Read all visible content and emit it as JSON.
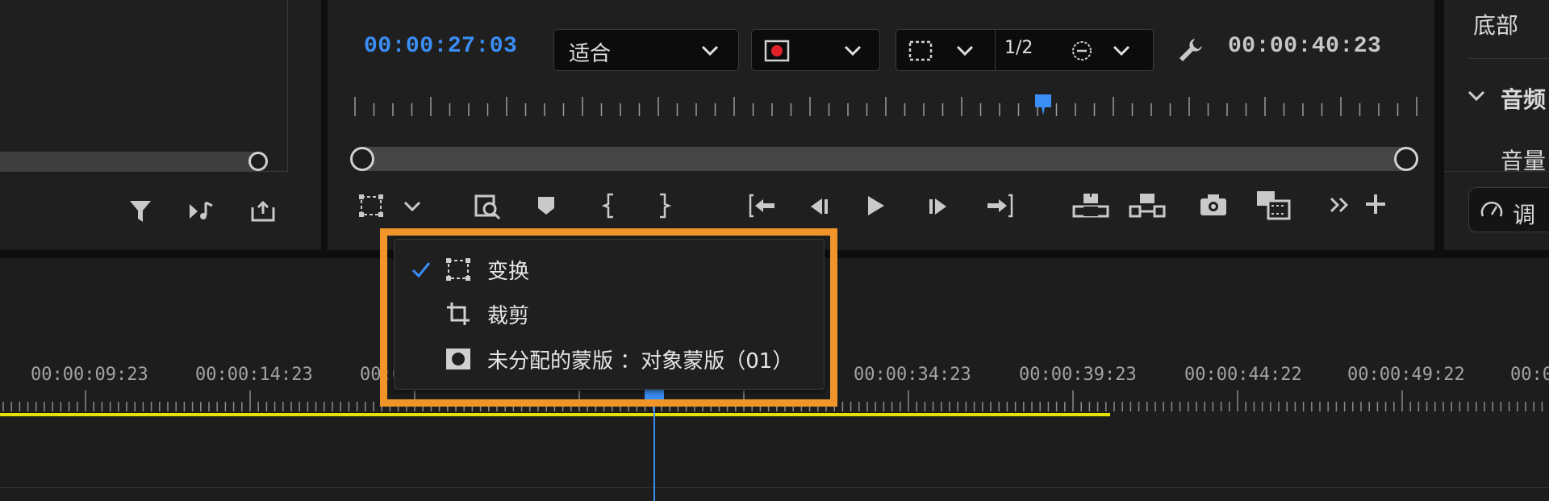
{
  "source_panel": {
    "icons": [
      "filter-icon",
      "audio-output-icon",
      "export-icon"
    ]
  },
  "program_monitor": {
    "current_timecode": "00:00:27:03",
    "zoom_select": "适合",
    "resolution_label": "1/2",
    "duration_timecode": "00:00:40:23"
  },
  "overlay_menu": {
    "items": [
      {
        "label": "变换",
        "checked": true,
        "icon": "transform-icon"
      },
      {
        "label": "裁剪",
        "checked": false,
        "icon": "crop-icon"
      },
      {
        "label": "未分配的蒙版 ：对象蒙版（01）",
        "checked": false,
        "icon": "mask-icon"
      }
    ]
  },
  "timeline": {
    "ruler_labels": [
      "00:00:09:23",
      "00:00:14:23",
      "00:0",
      "00:00:34:23",
      "00:00:39:23",
      "00:00:44:22",
      "00:00:49:22",
      "00:0"
    ]
  },
  "right_panel": {
    "label_bottom": "底部",
    "section_audio": "音频",
    "label_volume": "音量",
    "button_adjust": "调"
  },
  "colors": {
    "accent_blue": "#3a8ef5",
    "highlight_orange": "#f0952a",
    "work_area_yellow": "#e8e000"
  }
}
